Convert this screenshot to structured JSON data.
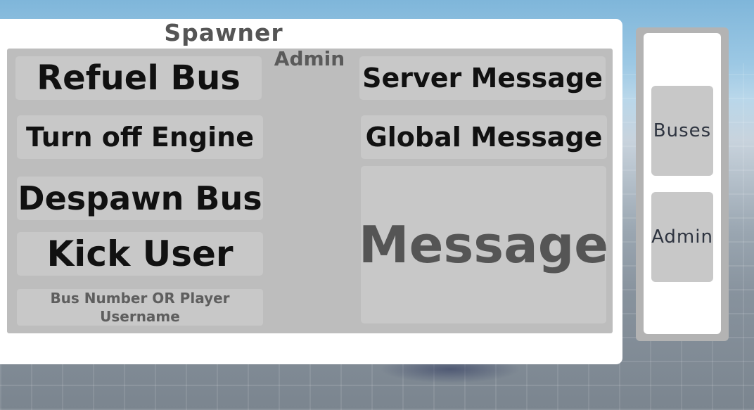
{
  "spawner": {
    "title": "Spawner",
    "admin_title": "Admin",
    "buttons": {
      "refuel": "Refuel Bus",
      "engine_off": "Turn off Engine",
      "despawn": "Despawn Bus",
      "kick": "Kick User",
      "server_message": "Server Message",
      "global_message": "Global Message"
    },
    "target_input": {
      "placeholder": "Bus Number OR Player\nUsername"
    },
    "message_box": {
      "placeholder": "Message"
    }
  },
  "side_panel": {
    "tabs": [
      "Buses",
      "Admin"
    ]
  },
  "colors": {
    "panel_bg": "#ffffff",
    "admin_area_bg": "#bdbdbd",
    "button_bg": "#c8c8c8",
    "button_text": "#111111",
    "title_text": "#555555",
    "side_frame": "#b3b3b3"
  }
}
